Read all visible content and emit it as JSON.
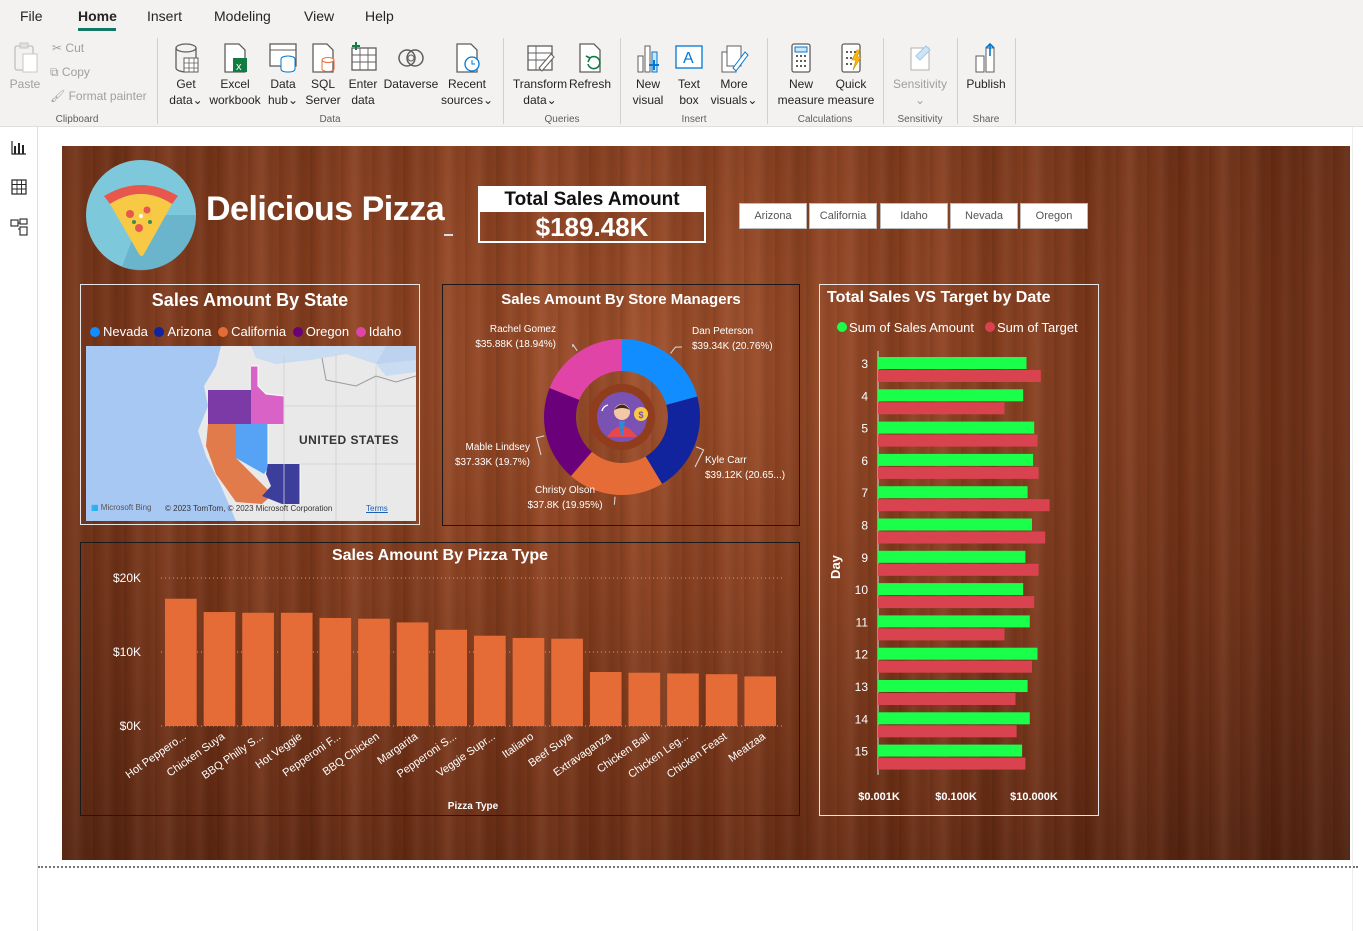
{
  "menu": {
    "file": "File",
    "home": "Home",
    "insert": "Insert",
    "modeling": "Modeling",
    "view": "View",
    "help": "Help"
  },
  "ribbon": {
    "paste": "Paste",
    "cut": "Cut",
    "copy": "Copy",
    "format_painter": "Format painter",
    "clipboard": "Clipboard",
    "get_data": [
      "Get",
      "data"
    ],
    "excel": [
      "Excel",
      "workbook"
    ],
    "data_hub": [
      "Data",
      "hub"
    ],
    "sql": [
      "SQL",
      "Server"
    ],
    "enter_data": [
      "Enter",
      "data"
    ],
    "dataverse": "Dataverse",
    "recent": [
      "Recent",
      "sources"
    ],
    "data_group": "Data",
    "transform": [
      "Transform",
      "data"
    ],
    "refresh": "Refresh",
    "queries": "Queries",
    "new_visual": [
      "New",
      "visual"
    ],
    "text_box": [
      "Text",
      "box"
    ],
    "more_visuals": [
      "More",
      "visuals"
    ],
    "insert_group": "Insert",
    "new_measure": [
      "New",
      "measure"
    ],
    "quick_measure": [
      "Quick",
      "measure"
    ],
    "calculations": "Calculations",
    "sensitivity": "Sensitivity",
    "sensitivity_group": "Sensitivity",
    "publish": "Publish",
    "share": "Share"
  },
  "report": {
    "title": "Delicious Pizza",
    "kpi_label": "Total Sales Amount",
    "kpi_value": "$189.48K",
    "slicers": [
      "Arizona",
      "California",
      "Idaho",
      "Nevada",
      "Oregon"
    ],
    "map": {
      "title": "Sales Amount By State",
      "legend": [
        {
          "name": "Nevada",
          "color": "#118dff"
        },
        {
          "name": "Arizona",
          "color": "#12239e"
        },
        {
          "name": "California",
          "color": "#e66c37"
        },
        {
          "name": "Oregon",
          "color": "#6b007b"
        },
        {
          "name": "Idaho",
          "color": "#e044a7"
        }
      ],
      "country_label": "UNITED STATES",
      "bing": "Microsoft Bing",
      "copyright": "© 2023 TomTom, © 2023 Microsoft Corporation",
      "terms": "Terms"
    },
    "donut_title": "Sales Amount By Store Managers",
    "bar_title": "Sales Amount By Pizza Type",
    "combo_title": "Total Sales VS Target by Date"
  },
  "chart_data": [
    {
      "type": "pie",
      "title": "Sales Amount By Store Managers",
      "slices": [
        {
          "name": "Dan Peterson",
          "value": 39.34,
          "label": "$39.34K (20.76%)",
          "color": "#118dff"
        },
        {
          "name": "Kyle Carr",
          "value": 39.12,
          "label": "$39.12K (20.65...)",
          "color": "#12239e"
        },
        {
          "name": "Christy Olson",
          "value": 37.8,
          "label": "$37.8K (19.95%)",
          "color": "#e66c37"
        },
        {
          "name": "Mable Lindsey",
          "value": 37.33,
          "label": "$37.33K (19.7%)",
          "color": "#6b007b"
        },
        {
          "name": "Rachel Gomez",
          "value": 35.88,
          "label": "$35.88K (18.94%)",
          "color": "#e044a7"
        }
      ]
    },
    {
      "type": "bar",
      "title": "Sales Amount By Pizza Type",
      "xlabel": "Pizza Type",
      "ylabel": "",
      "categories": [
        "Hot Peppero...",
        "Chicken Suya",
        "BBQ Philly S...",
        "Hot Veggie",
        "Pepperoni F...",
        "BBQ Chicken",
        "Margarita",
        "Pepperoni S...",
        "Veggie Supr...",
        "Italiano",
        "Beef Suya",
        "Extravaganza",
        "Chicken Bali",
        "Chicken Leg...",
        "Chicken Feast",
        "Meatzaa"
      ],
      "values": [
        17200,
        15400,
        15300,
        15300,
        14600,
        14500,
        14000,
        13000,
        12200,
        11900,
        11800,
        7300,
        7200,
        7100,
        7000,
        6700
      ],
      "yticks": [
        "$0K",
        "$10K",
        "$20K"
      ],
      "ylim": [
        0,
        20000
      ],
      "color": "#e66c37"
    },
    {
      "type": "bar",
      "title": "Total Sales VS Target by Date",
      "orientation": "horizontal",
      "ylabel": "Day",
      "scale": "log",
      "categories": [
        "3",
        "4",
        "5",
        "6",
        "7",
        "8",
        "9",
        "10",
        "11",
        "12",
        "13",
        "14",
        "15"
      ],
      "xticks": [
        "$0.001K",
        "$0.100K",
        "$10.000K"
      ],
      "series": [
        {
          "name": "Sum of Sales Amount",
          "color": "#1aff4a",
          "values": [
            13.5,
            13.2,
            14.2,
            14.1,
            13.6,
            14.0,
            13.4,
            13.2,
            13.8,
            14.5,
            13.6,
            13.8,
            13.1
          ]
        },
        {
          "name": "Sum of Target",
          "color": "#d9434f",
          "values": [
            14.8,
            11.5,
            14.5,
            14.6,
            15.6,
            15.2,
            14.6,
            14.2,
            11.5,
            14.0,
            12.5,
            12.6,
            13.4
          ]
        }
      ]
    }
  ]
}
